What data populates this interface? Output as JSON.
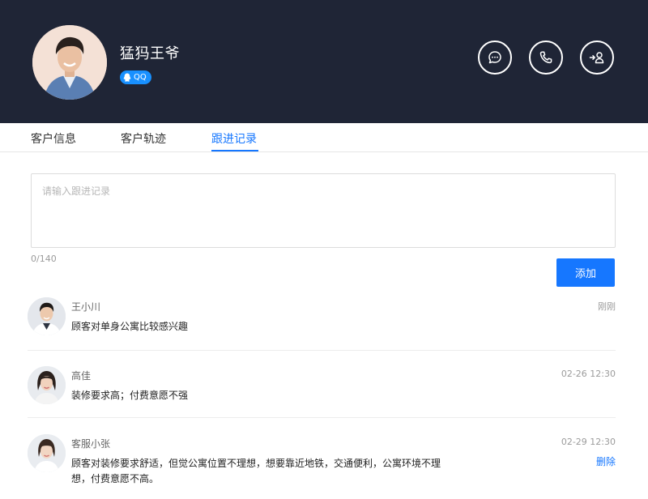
{
  "profile": {
    "name": "猛犸王爷",
    "badge": "QQ"
  },
  "actions": {
    "message_icon": "chat-icon",
    "call_icon": "phone-icon",
    "transfer_icon": "transfer-user-icon"
  },
  "tabs": [
    {
      "label": "客户信息",
      "active": false
    },
    {
      "label": "客户轨迹",
      "active": false
    },
    {
      "label": "跟进记录",
      "active": true
    }
  ],
  "followup": {
    "placeholder": "请输入跟进记录",
    "counter": "0/140",
    "add_label": "添加"
  },
  "records": [
    {
      "author": "王小川",
      "text": "顾客对单身公寓比较感兴趣",
      "time": "刚刚"
    },
    {
      "author": "高佳",
      "text": "装修要求高；付费意愿不强",
      "time": "02-26  12:30"
    },
    {
      "author": "客服小张",
      "text": "顾客对装修要求舒适，但觉公寓位置不理想，想要靠近地铁，交通便利，公寓环境不理想，付费意愿不高。",
      "time": "02-29  12:30",
      "delete_label": "删除"
    }
  ],
  "colors": {
    "header_bg": "#1f2536",
    "accent": "#1677ff"
  }
}
